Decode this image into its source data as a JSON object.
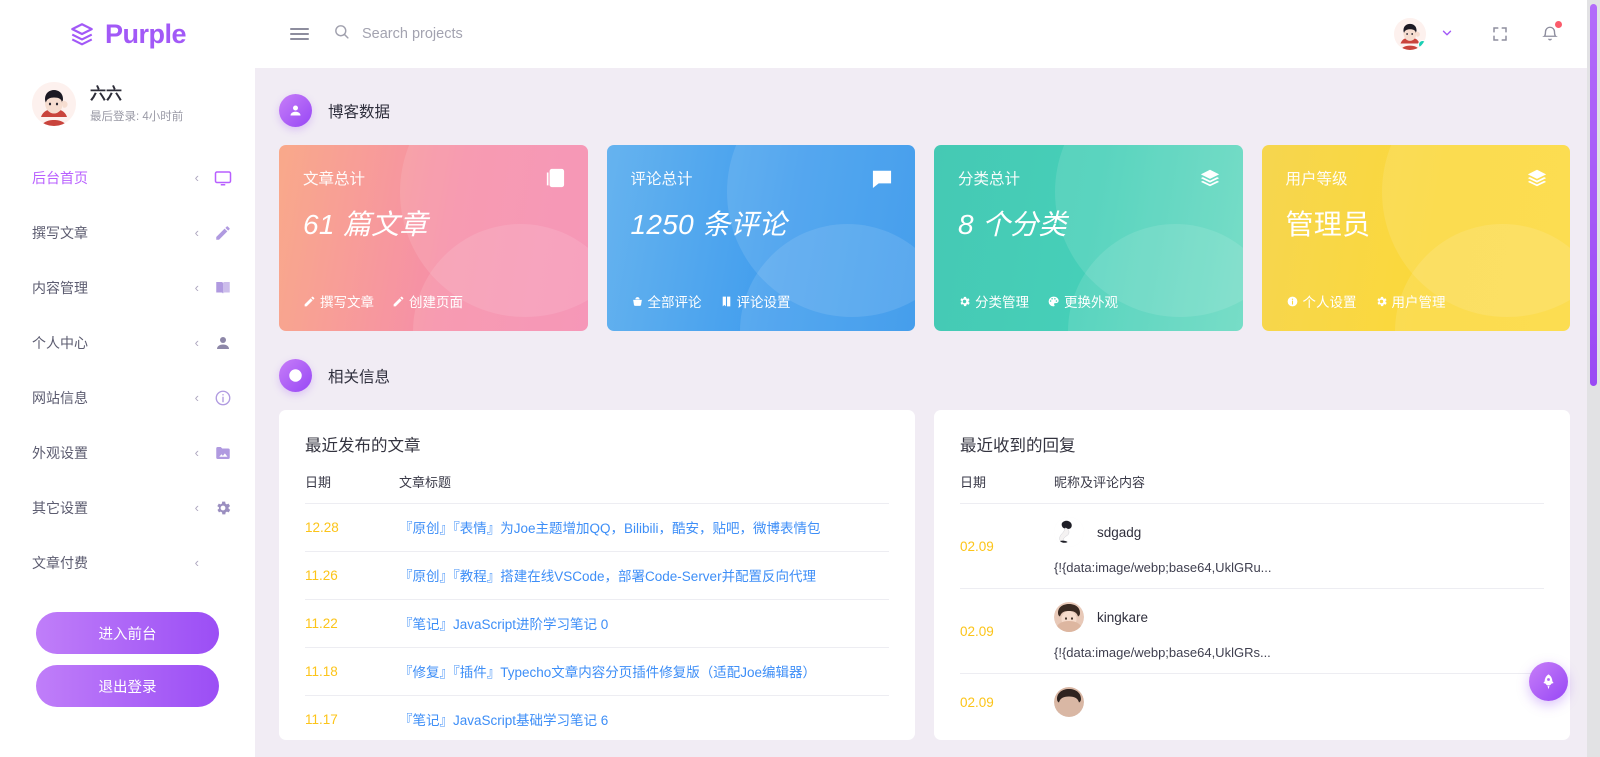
{
  "brand": {
    "name": "Purple",
    "logo_icon": "layers-icon"
  },
  "profile": {
    "name": "六六",
    "last_login": "最后登录: 4小时前",
    "avatar_icon": "user-avatar"
  },
  "sidebar": {
    "items": [
      {
        "label": "后台首页",
        "icon": "monitor-icon",
        "active": true
      },
      {
        "label": "撰写文章",
        "icon": "pencil-icon",
        "active": false
      },
      {
        "label": "内容管理",
        "icon": "book-icon",
        "active": false
      },
      {
        "label": "个人中心",
        "icon": "person-icon",
        "active": false
      },
      {
        "label": "网站信息",
        "icon": "info-circle-icon",
        "active": false
      },
      {
        "label": "外观设置",
        "icon": "image-folder-icon",
        "active": false
      },
      {
        "label": "其它设置",
        "icon": "gear-icon",
        "active": false
      },
      {
        "label": "文章付费",
        "icon": "",
        "active": false
      }
    ],
    "chevron": "‹",
    "buttons": {
      "front": "进入前台",
      "logout": "退出登录"
    }
  },
  "topbar": {
    "menu_icon": "hamburger-icon",
    "search_icon": "search-icon",
    "search_placeholder": "Search projects",
    "search_value": "",
    "chevron_down": "⌄",
    "fullscreen_icon": "fullscreen-icon",
    "bell_icon": "bell-icon",
    "has_notification": true
  },
  "sections": {
    "stats": {
      "title": "博客数据",
      "icon": "person-icon"
    },
    "info": {
      "title": "相关信息",
      "icon": "info-circle-icon"
    }
  },
  "cards": [
    {
      "title": "文章总计",
      "value": "61 篇文章",
      "italic": true,
      "icon": "documents-icon",
      "color": "#f68fa8",
      "links": [
        {
          "label": "撰写文章",
          "icon": "pencil-icon"
        },
        {
          "label": "创建页面",
          "icon": "pencil-icon"
        }
      ]
    },
    {
      "title": "评论总计",
      "value": "1250 条评论",
      "italic": true,
      "icon": "comment-icon",
      "color": "#3f9ced",
      "links": [
        {
          "label": "全部评论",
          "icon": "basket-icon"
        },
        {
          "label": "评论设置",
          "icon": "book-icon"
        }
      ]
    },
    {
      "title": "分类总计",
      "value": "8 个分类",
      "italic": true,
      "icon": "layers-icon",
      "color": "#46cfb8",
      "links": [
        {
          "label": "分类管理",
          "icon": "gear-icon"
        },
        {
          "label": "更换外观",
          "icon": "palette-icon"
        }
      ]
    },
    {
      "title": "用户等级",
      "value": "管理员",
      "italic": false,
      "icon": "layers-icon",
      "color": "#fbd83b",
      "links": [
        {
          "label": "个人设置",
          "icon": "info-circle-icon"
        },
        {
          "label": "用户管理",
          "icon": "gear-icon"
        }
      ]
    }
  ],
  "articles_panel": {
    "title": "最近发布的文章",
    "columns": [
      "日期",
      "文章标题"
    ],
    "rows": [
      {
        "date": "12.28",
        "title": "『原创』『表情』为Joe主题增加QQ，Bilibili，酷安，贴吧，微博表情包"
      },
      {
        "date": "11.26",
        "title": "『原创』『教程』搭建在线VSCode，部署Code-Server并配置反向代理"
      },
      {
        "date": "11.22",
        "title": "『笔记』JavaScript进阶学习笔记 0"
      },
      {
        "date": "11.18",
        "title": "『修复』『插件』Typecho文章内容分页插件修复版（适配Joe编辑器）"
      },
      {
        "date": "11.17",
        "title": "『笔记』JavaScript基础学习笔记 6"
      }
    ]
  },
  "replies_panel": {
    "title": "最近收到的回复",
    "columns": [
      "日期",
      "昵称及评论内容"
    ],
    "rows": [
      {
        "date": "02.09",
        "nick": "sdgadg",
        "body": "{!{data:image/webp;base64,UklGRu..."
      },
      {
        "date": "02.09",
        "nick": "kingkare",
        "body": "{!{data:image/webp;base64,UklGRs..."
      },
      {
        "date": "02.09",
        "nick": "",
        "body": ""
      }
    ]
  },
  "fab": {
    "icon": "rocket-icon"
  }
}
